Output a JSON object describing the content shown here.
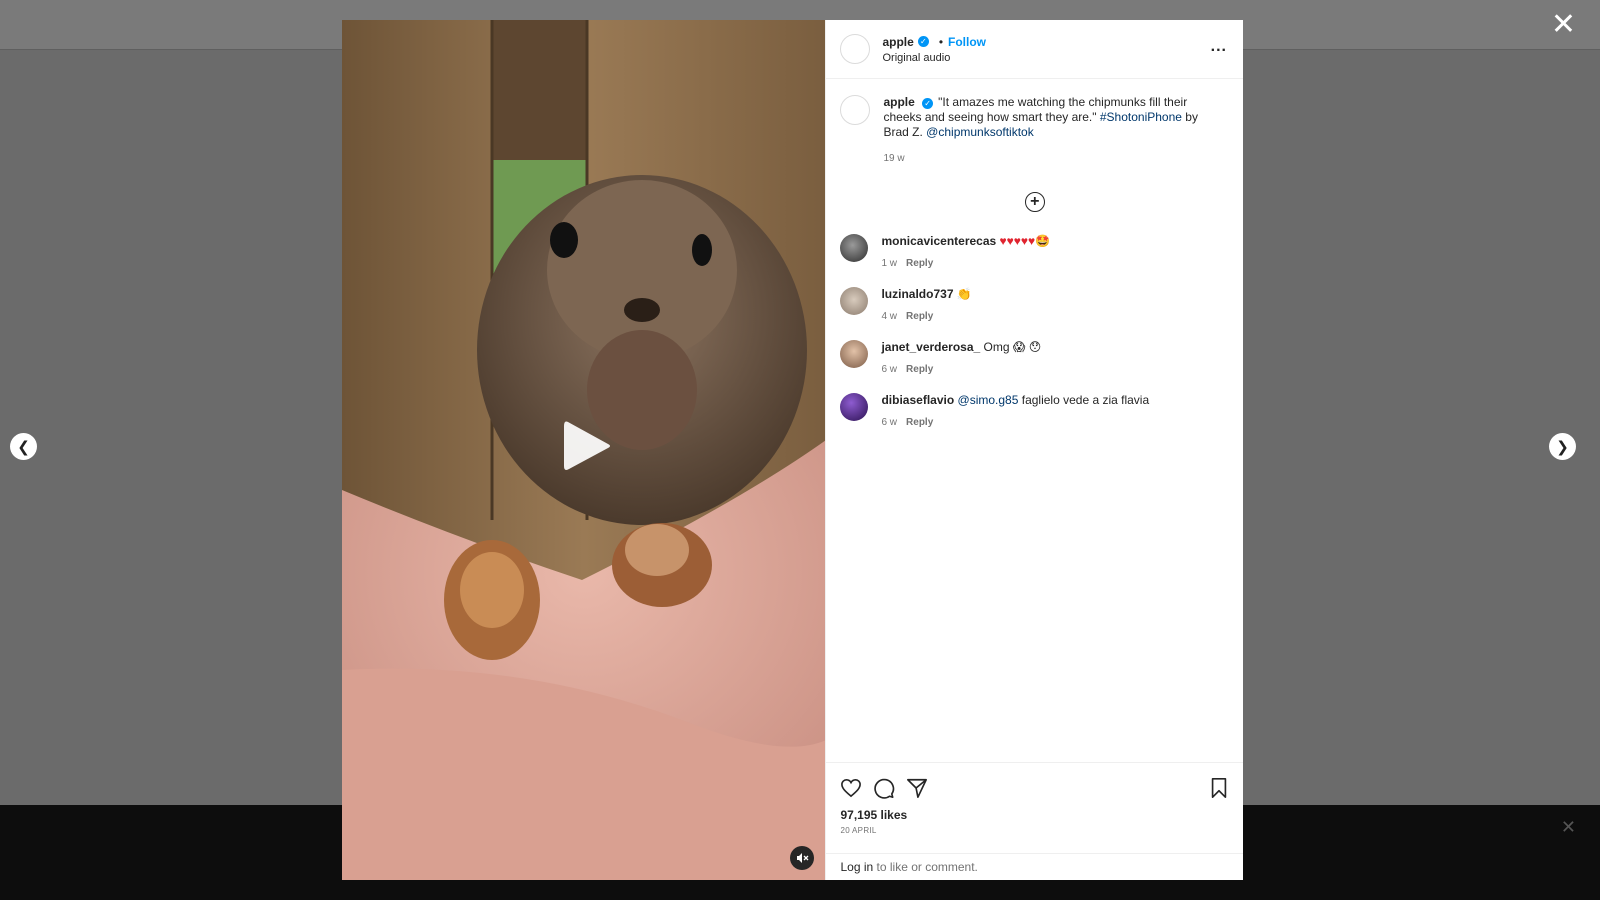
{
  "post": {
    "username": "apple",
    "follow_label": "Follow",
    "separator": "•",
    "audio": "Original audio",
    "more_label": "...",
    "caption": {
      "text_before": "\"It amazes me watching the chipmunks fill their cheeks and seeing how smart they are.\"",
      "hashtag": "#ShotoniPhone",
      "text_middle": "by Brad Z.",
      "mention": "@chipmunksoftiktok",
      "time": "19 w"
    },
    "load_more_label": "+"
  },
  "comments": [
    {
      "user": "monicavicenterecas",
      "text": "♥♥♥♥♥🤩",
      "time": "1 w",
      "reply": "Reply",
      "avatar_color": "#3a3a3a"
    },
    {
      "user": "luzinaldo737",
      "text": "👏",
      "time": "4 w",
      "reply": "Reply",
      "avatar_color": "#c9b8a6"
    },
    {
      "user": "janet_verderosa_",
      "text": "Omg 😱 😯",
      "time": "6 w",
      "reply": "Reply",
      "avatar_color": "#b78a6e"
    },
    {
      "user": "dibiaseflavio",
      "mention": "@simo.g85",
      "text": "faglielo vede a zia flavia",
      "time": "6 w",
      "reply": "Reply",
      "avatar_color": "#5b2c8f"
    }
  ],
  "footer": {
    "likes": "97,195 likes",
    "date": "20 APRIL",
    "login_link": "Log in",
    "login_rest": "to like or comment."
  },
  "icons": {
    "close": "close-icon",
    "prev": "chevron-left-icon",
    "next": "chevron-right-icon",
    "play": "play-icon",
    "mute": "muted-speaker-icon",
    "like": "heart-icon",
    "comment": "comment-icon",
    "share": "paper-plane-icon",
    "save": "bookmark-icon"
  },
  "colors": {
    "accent": "#0095f6",
    "heart": "#e0242f"
  }
}
